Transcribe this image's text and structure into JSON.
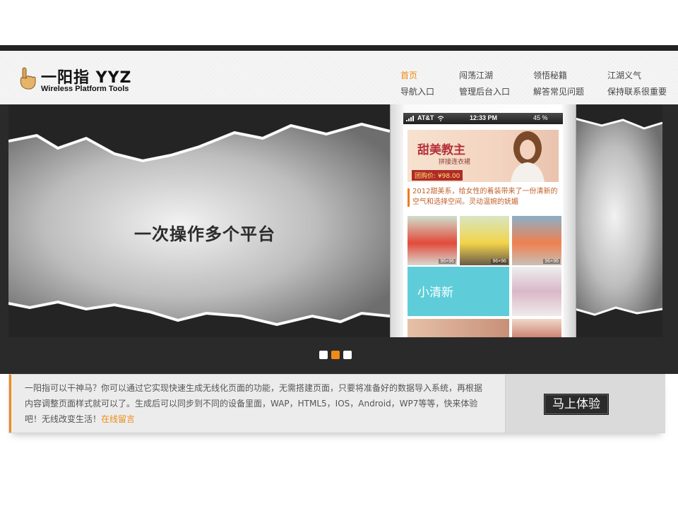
{
  "logo": {
    "title": "一阳指 YYZ",
    "subtitle": "Wireless Platform Tools",
    "icon": "pointing-hand-icon"
  },
  "nav": {
    "row1": [
      "首页",
      "闯荡江湖",
      "领悟秘籍",
      "江湖义气"
    ],
    "row2": [
      "导航入口",
      "管理后台入口",
      "解答常见问题",
      "保持联系很重要"
    ],
    "active": "首页"
  },
  "banner": {
    "slogan": "一次操作多个平台",
    "phone": {
      "carrier": "AT&T",
      "time": "12:33 PM",
      "battery": "45 %",
      "promo_title": "甜美教主",
      "promo_subtitle": "拼接连衣裙",
      "promo_price": "团购价: ¥98.00",
      "caption": "2012甜美系，给女性的着装带来了一份清新的空气和选择空间。灵动温婉的妩媚",
      "thumb_tag": "96×96",
      "teal_label": "小清新"
    },
    "slides": 3,
    "active_slide": 2
  },
  "info": {
    "text": "一阳指可以干神马？你可以通过它实现快速生成无线化页面的功能，无需搭建页面，只要将准备好的数据导入系统，再根据内容调整页面样式就可以了。生成后可以同步到不同的设备里面，WAP，HTML5，IOS，Android，WP7等等，快来体验吧！无线改变生活！",
    "link": "在线留言",
    "button": "马上体验"
  },
  "colors": {
    "accent": "#f08a18",
    "dark": "#2a2a2a",
    "teal": "#5ecdd9"
  }
}
